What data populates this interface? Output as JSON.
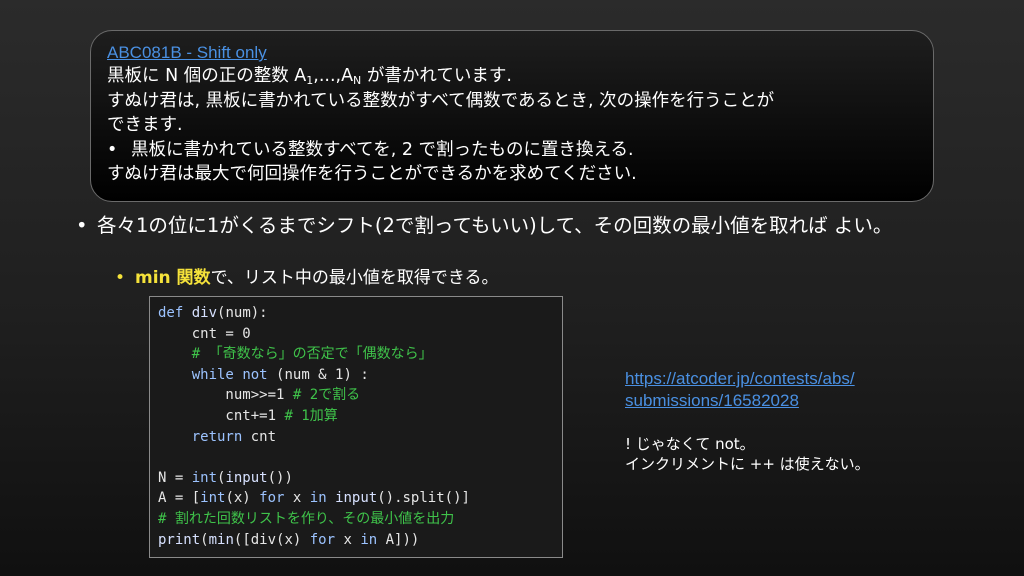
{
  "problem": {
    "link_text": "ABC081B - Shift only",
    "line1_a": "黒板に N 個の正の整数 A",
    "line1_sub1": "1",
    "line1_b": ",...,A",
    "line1_subN": "N",
    "line1_c": " が書かれています.",
    "line2": "すぬけ君は, 黒板に書かれている整数がすべて偶数であるとき, 次の操作を行うことが",
    "line3": "できます.",
    "bullet_symbol": "•",
    "line4": "黒板に書かれている整数すべてを, 2 で割ったものに置き換える.",
    "line5": "すぬけ君は最大で何回操作を行うことができるかを求めてください."
  },
  "main_bullet": {
    "symbol": "•",
    "text": "各々1の位に1がくるまでシフト(2で割ってもいい)して、その回数の最小値を取れば よい。"
  },
  "sub_bullet": {
    "symbol": "•",
    "highlight": "min 関数",
    "rest": "で、リスト中の最小値を取得できる。"
  },
  "code": {
    "lines": [
      [
        {
          "t": "def",
          "c": "kw"
        },
        {
          "t": " ",
          "c": "pl"
        },
        {
          "t": "div",
          "c": "fn"
        },
        {
          "t": "(num):",
          "c": "pl"
        }
      ],
      [
        {
          "t": "    cnt = 0",
          "c": "pl"
        }
      ],
      [
        {
          "t": "    # 「奇数なら」の否定で「偶数なら」",
          "c": "cm"
        }
      ],
      [
        {
          "t": "    ",
          "c": "pl"
        },
        {
          "t": "while",
          "c": "kw"
        },
        {
          "t": " ",
          "c": "pl"
        },
        {
          "t": "not",
          "c": "kw"
        },
        {
          "t": " (num & 1) :",
          "c": "pl"
        }
      ],
      [
        {
          "t": "        num>>=1 ",
          "c": "pl"
        },
        {
          "t": "# 2で割る",
          "c": "cm"
        }
      ],
      [
        {
          "t": "        cnt+=1 ",
          "c": "pl"
        },
        {
          "t": "# 1加算",
          "c": "cm"
        }
      ],
      [
        {
          "t": "    ",
          "c": "pl"
        },
        {
          "t": "return",
          "c": "kw"
        },
        {
          "t": " cnt",
          "c": "pl"
        }
      ],
      [
        {
          "t": "",
          "c": "pl"
        }
      ],
      [
        {
          "t": "N = ",
          "c": "pl"
        },
        {
          "t": "int",
          "c": "kw"
        },
        {
          "t": "(",
          "c": "pl"
        },
        {
          "t": "input",
          "c": "fn"
        },
        {
          "t": "())",
          "c": "pl"
        }
      ],
      [
        {
          "t": "A = [",
          "c": "pl"
        },
        {
          "t": "int",
          "c": "kw"
        },
        {
          "t": "(x) ",
          "c": "pl"
        },
        {
          "t": "for",
          "c": "kw"
        },
        {
          "t": " x ",
          "c": "pl"
        },
        {
          "t": "in",
          "c": "kw"
        },
        {
          "t": " ",
          "c": "pl"
        },
        {
          "t": "input",
          "c": "fn"
        },
        {
          "t": "().split()]",
          "c": "pl"
        }
      ],
      [
        {
          "t": "# 割れた回数リストを作り、その最小値を出力",
          "c": "cm"
        }
      ],
      [
        {
          "t": "print",
          "c": "fn"
        },
        {
          "t": "(",
          "c": "pl"
        },
        {
          "t": "min",
          "c": "fn"
        },
        {
          "t": "([div(x) ",
          "c": "pl"
        },
        {
          "t": "for",
          "c": "kw"
        },
        {
          "t": " x ",
          "c": "pl"
        },
        {
          "t": "in",
          "c": "kw"
        },
        {
          "t": " A]))",
          "c": "pl"
        }
      ]
    ]
  },
  "submission_link": {
    "line1": "https://atcoder.jp/contests/abs/",
    "line2": "submissions/16582028"
  },
  "note": {
    "line1": "! じゃなくて not。",
    "line2": "インクリメントに ++ は使えない。"
  }
}
